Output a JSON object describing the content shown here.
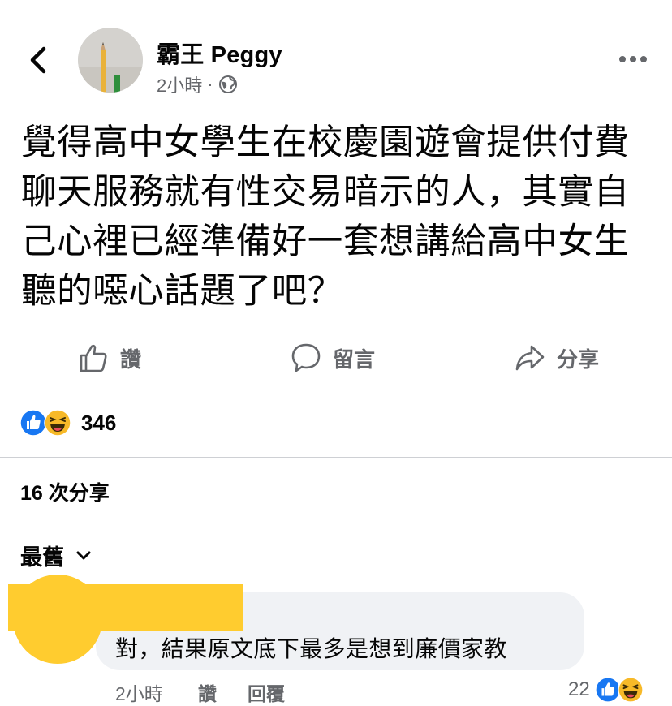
{
  "header": {
    "author": "霸王 Peggy",
    "time": "2小時",
    "dot": "·",
    "privacy_icon": "globe-icon",
    "back_icon": "chevron-left-icon",
    "more_icon": "more-dots-icon"
  },
  "post": {
    "text": "覺得高中女學生在校慶園遊會提供付費聊天服務就有性交易暗示的人，其實自己心裡已經準備好一套想講給高中女生聽的噁心話題了吧？"
  },
  "actions": {
    "like_label": "讚",
    "comment_label": "留言",
    "share_label": "分享"
  },
  "reactions": {
    "types": [
      "like",
      "haha"
    ],
    "count": "346"
  },
  "shares": {
    "label": "16 次分享"
  },
  "comments_sort": {
    "label": "最舊"
  },
  "comment": {
    "text": "對，結果原文底下最多是想到廉價家教",
    "time": "2小時",
    "like_label": "讚",
    "reply_label": "回覆",
    "reaction_count": "22"
  },
  "colors": {
    "like_blue": "#1877f2",
    "haha_yellow": "#f7b928",
    "redaction_yellow": "#ffcc2f",
    "secondary_text": "#65676b",
    "bubble": "#f0f2f5"
  }
}
